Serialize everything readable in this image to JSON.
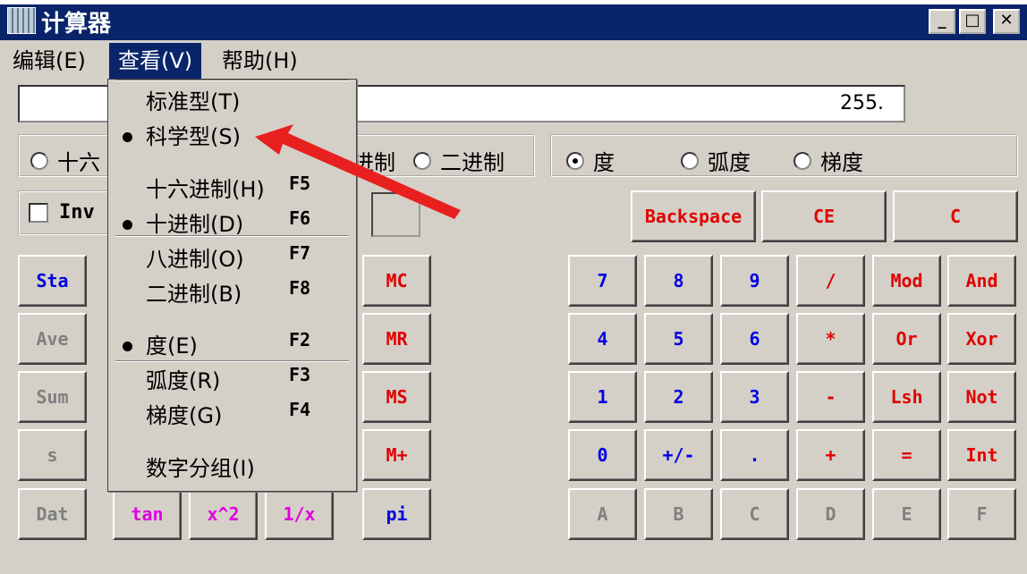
{
  "window": {
    "title": "计算器",
    "min": "_",
    "max": "□",
    "close": "✕"
  },
  "menubar": [
    {
      "label": "编辑(E)"
    },
    {
      "label": "查看(V)"
    },
    {
      "label": "帮助(H)"
    }
  ],
  "display": {
    "value": "255."
  },
  "base_radios": [
    {
      "label": "十六",
      "checked": false
    },
    {
      "label": "进制",
      "checked": false
    },
    {
      "label": "二进制",
      "checked": false
    }
  ],
  "angle_radios": [
    {
      "label": "度",
      "checked": true
    },
    {
      "label": "弧度",
      "checked": false
    },
    {
      "label": "梯度",
      "checked": false
    }
  ],
  "inv": {
    "label": "Inv",
    "checked": false
  },
  "edit_buttons": [
    "Backspace",
    "CE",
    "C"
  ],
  "stat_buttons": [
    "Sta",
    "Ave",
    "Sum",
    "s",
    "Dat"
  ],
  "func_buttons": [
    "tan",
    "x^2",
    "1/x"
  ],
  "memory_buttons": [
    "MC",
    "MR",
    "MS",
    "M+",
    "pi"
  ],
  "keypad": [
    [
      "7",
      "8",
      "9",
      "/",
      "Mod",
      "And"
    ],
    [
      "4",
      "5",
      "6",
      "*",
      "Or",
      "Xor"
    ],
    [
      "1",
      "2",
      "3",
      "-",
      "Lsh",
      "Not"
    ],
    [
      "0",
      "+/-",
      ".",
      "+",
      "=",
      "Int"
    ],
    [
      "A",
      "B",
      "C",
      "D",
      "E",
      "F"
    ]
  ],
  "view_menu": {
    "items": [
      {
        "label": "标准型(T)",
        "key": "",
        "checked": false
      },
      {
        "label": "科学型(S)",
        "key": "",
        "checked": true
      },
      {
        "label": "十六进制(H)",
        "key": "F5",
        "checked": false
      },
      {
        "label": "十进制(D)",
        "key": "F6",
        "checked": true
      },
      {
        "label": "八进制(O)",
        "key": "F7",
        "checked": false
      },
      {
        "label": "二进制(B)",
        "key": "F8",
        "checked": false
      },
      {
        "label": "度(E)",
        "key": "F2",
        "checked": true
      },
      {
        "label": "弧度(R)",
        "key": "F3",
        "checked": false
      },
      {
        "label": "梯度(G)",
        "key": "F4",
        "checked": false
      },
      {
        "label": "数字分组(I)",
        "key": "",
        "checked": false
      }
    ]
  },
  "annotation": {
    "arrow_color": "#e82020"
  }
}
